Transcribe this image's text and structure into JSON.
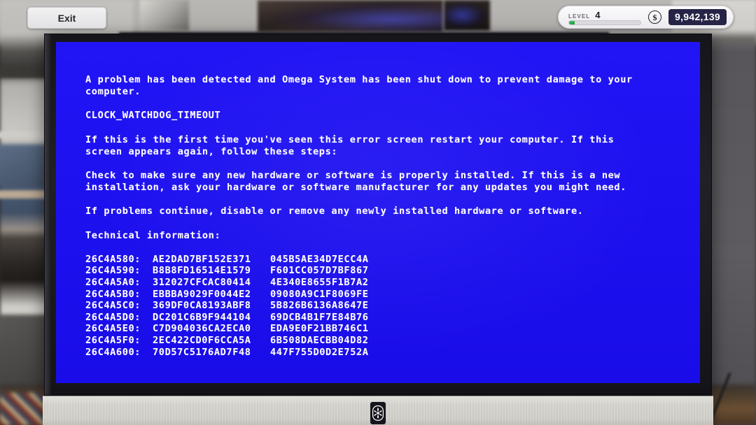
{
  "hud": {
    "exit_label": "Exit",
    "level_label": "LEVEL",
    "level_value": "4",
    "level_progress_percent": 8,
    "currency_icon": "dollar-coin-icon",
    "currency_symbol": "$",
    "money_value": "9,942,139"
  },
  "monitor": {
    "screen_color": "#1a0df5",
    "text_color": "#ffffff",
    "badge_icon": "fan-logo-icon"
  },
  "bsod": {
    "intro": "A problem has been detected and Omega System has been shut down to prevent damage to your computer.",
    "stop_code": "CLOCK_WATCHDOG_TIMEOUT",
    "paragraph_restart": "If this is the first time you've seen this error screen restart your computer. If this screen appears again, follow these steps:",
    "paragraph_hardware": "Check to make sure any new hardware or software is properly installed. If this is a new installation, ask your hardware or software manufacturer for any updates you might need.",
    "paragraph_disable": "If problems continue, disable or remove any newly installed hardware or software.",
    "technical_heading": "Technical information:",
    "dump_rows": [
      {
        "address": "26C4A580:",
        "value_a": "AE2DAD7BF152E371",
        "value_b": "045B5AE34D7ECC4A"
      },
      {
        "address": "26C4A590:",
        "value_a": "B8B8FD16514E1579",
        "value_b": "F601CC057D7BF867"
      },
      {
        "address": "26C4A5A0:",
        "value_a": "312027CFCAC80414",
        "value_b": "4E340E8655F1B7A2"
      },
      {
        "address": "26C4A5B0:",
        "value_a": "EBBBA9029F0044E2",
        "value_b": "09080A9C1F8069FE"
      },
      {
        "address": "26C4A5C0:",
        "value_a": "369DF0CA8193ABF8",
        "value_b": "5B826B6136A8647E"
      },
      {
        "address": "26C4A5D0:",
        "value_a": "DC201C6B9F944104",
        "value_b": "69DCB4B1F7E84B76"
      },
      {
        "address": "26C4A5E0:",
        "value_a": "C7D904036CA2ECA0",
        "value_b": "EDA9E0F21BB746C1"
      },
      {
        "address": "26C4A5F0:",
        "value_a": "2EC422CD0F6CCA5A",
        "value_b": "6B508DAECBB04D82"
      },
      {
        "address": "26C4A600:",
        "value_a": "70D57C5176AD7F48",
        "value_b": "447F755D0D2E752A"
      }
    ]
  }
}
